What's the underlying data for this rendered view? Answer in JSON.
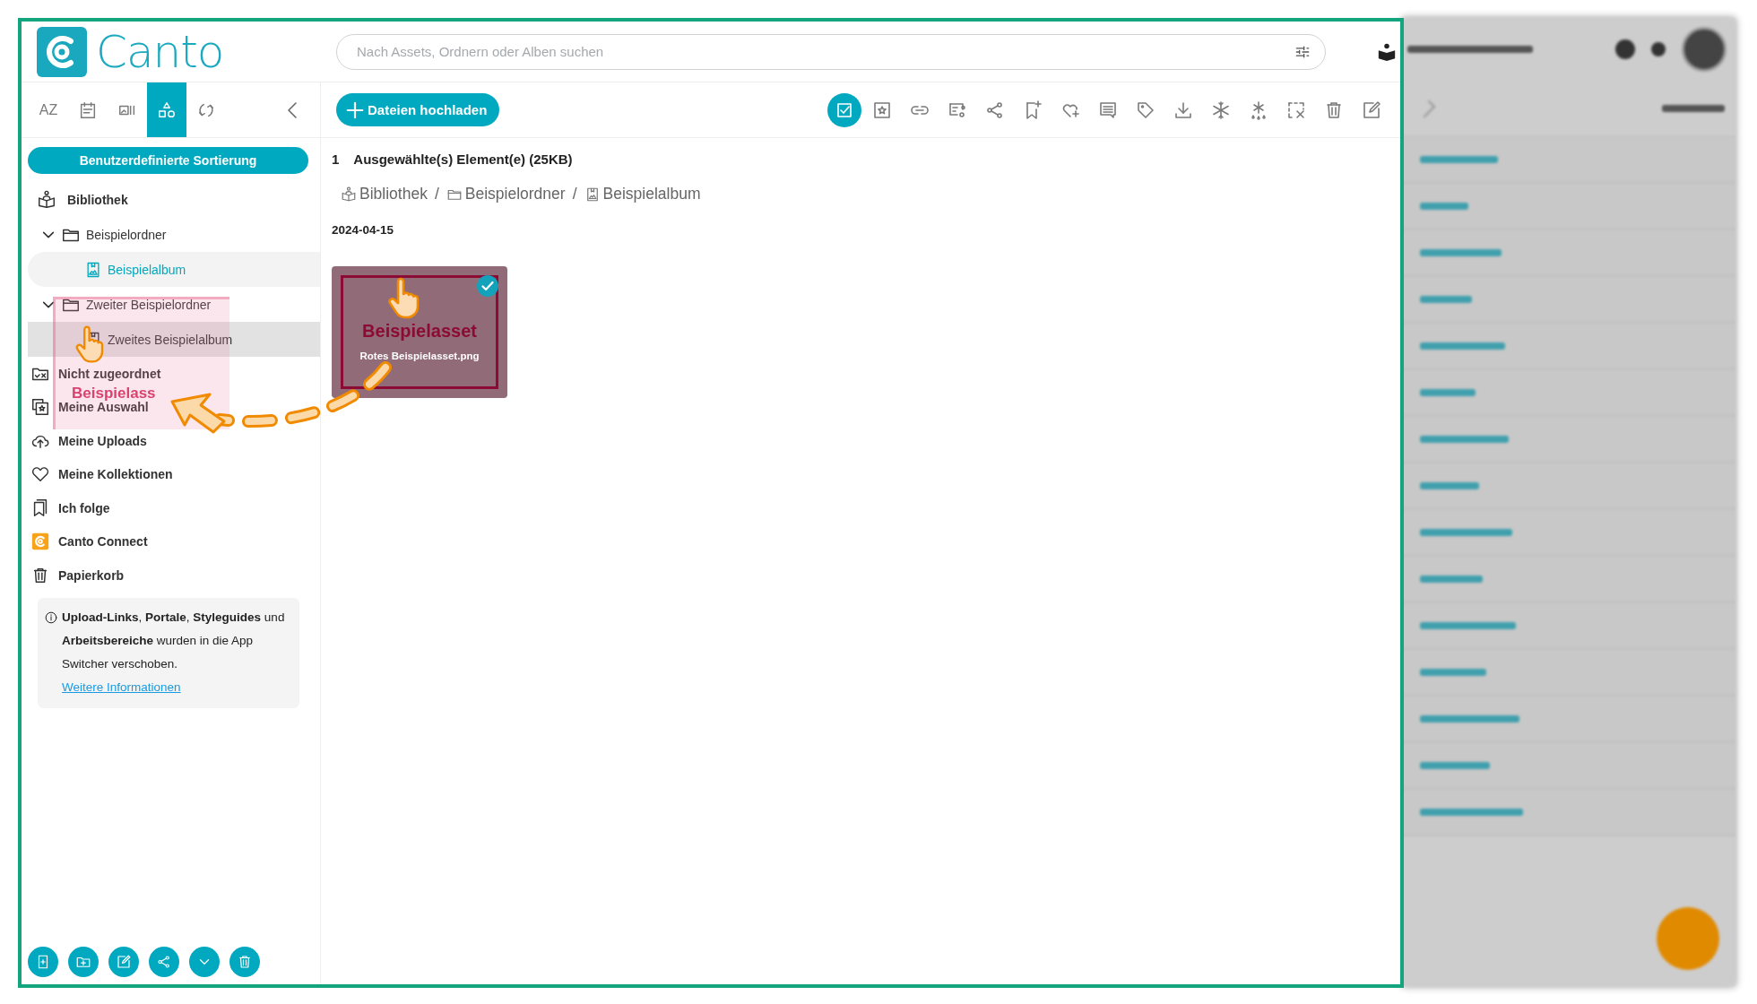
{
  "header": {
    "brand": "Canto",
    "search": {
      "placeholder": "Nach Assets, Ordnern oder Alben suchen"
    }
  },
  "sidebar": {
    "view_tabs": [
      {
        "kind": "text",
        "label": "AZ",
        "selected": false
      },
      {
        "kind": "calendar",
        "selected": false
      },
      {
        "kind": "gallery",
        "selected": false
      },
      {
        "kind": "shapes",
        "selected": true
      },
      {
        "kind": "sync",
        "selected": false
      }
    ],
    "sort_button": "Benutzerdefinierte Sortierung",
    "tree": [
      {
        "kind": "library",
        "label": "Bibliothek",
        "selected": false,
        "drop_target": false,
        "children": [
          {
            "kind": "folder",
            "label": "Beispielordner",
            "expanded": true,
            "selected": false,
            "drop_target": false,
            "children": [
              {
                "kind": "album",
                "label": "Beispielalbum",
                "selected": true,
                "drop_target": false
              }
            ]
          },
          {
            "kind": "folder",
            "label": "Zweiter Beispielordner",
            "expanded": true,
            "selected": false,
            "drop_target": false,
            "children": [
              {
                "kind": "album",
                "label": "Zweites Beispielalbum",
                "selected": false,
                "drop_target": true
              }
            ]
          }
        ]
      }
    ],
    "items": [
      {
        "kind": "unassigned",
        "label": "Nicht zugeordnet",
        "selected": false
      },
      {
        "kind": "selection",
        "label": "Meine Auswahl",
        "selected": false
      },
      {
        "kind": "uploads",
        "label": "Meine Uploads",
        "selected": false
      },
      {
        "kind": "collections",
        "label": "Meine Kollektionen",
        "selected": false
      },
      {
        "kind": "following",
        "label": "Ich folge",
        "selected": false
      },
      {
        "kind": "connect",
        "label": "Canto Connect",
        "selected": false
      },
      {
        "kind": "trash",
        "label": "Papierkorb",
        "selected": false
      }
    ],
    "notice": {
      "text": "**Upload-Links**, **Portale**, **Styleguides** und **Arbeitsbereiche** wurden in die App Switcher verschoben.",
      "link": "Weitere Informationen"
    }
  },
  "toolbar": {
    "upload_button": "Dateien hochladen",
    "tools": [
      {
        "active": true
      },
      {
        "active": false
      },
      {
        "active": false
      },
      {
        "active": false
      },
      {
        "active": false
      },
      {
        "active": false
      },
      {
        "active": false
      },
      {
        "active": false
      },
      {
        "active": false
      },
      {
        "active": false
      },
      {
        "active": false
      },
      {
        "active": false
      },
      {
        "active": false
      },
      {
        "active": false
      },
      {
        "active": false
      }
    ]
  },
  "content": {
    "selection": {
      "count": "1",
      "label": "Ausgewählte(s) Element(e) (25KB)"
    },
    "breadcrumb": [
      {
        "kind": "library",
        "label": "Bibliothek"
      },
      {
        "kind": "separator",
        "label": "/"
      },
      {
        "kind": "folder",
        "label": "Beispielordner"
      },
      {
        "kind": "separator",
        "label": "/"
      },
      {
        "kind": "album",
        "label": "Beispielalbum"
      }
    ],
    "groups": [
      {
        "date": "2024-04-15",
        "assets": [
          {
            "title": "Beispielasset",
            "filename": "Rotes Beispielasset.png",
            "selected": true
          }
        ]
      }
    ]
  },
  "drag": {
    "ghost_label": "Beispielass"
  }
}
